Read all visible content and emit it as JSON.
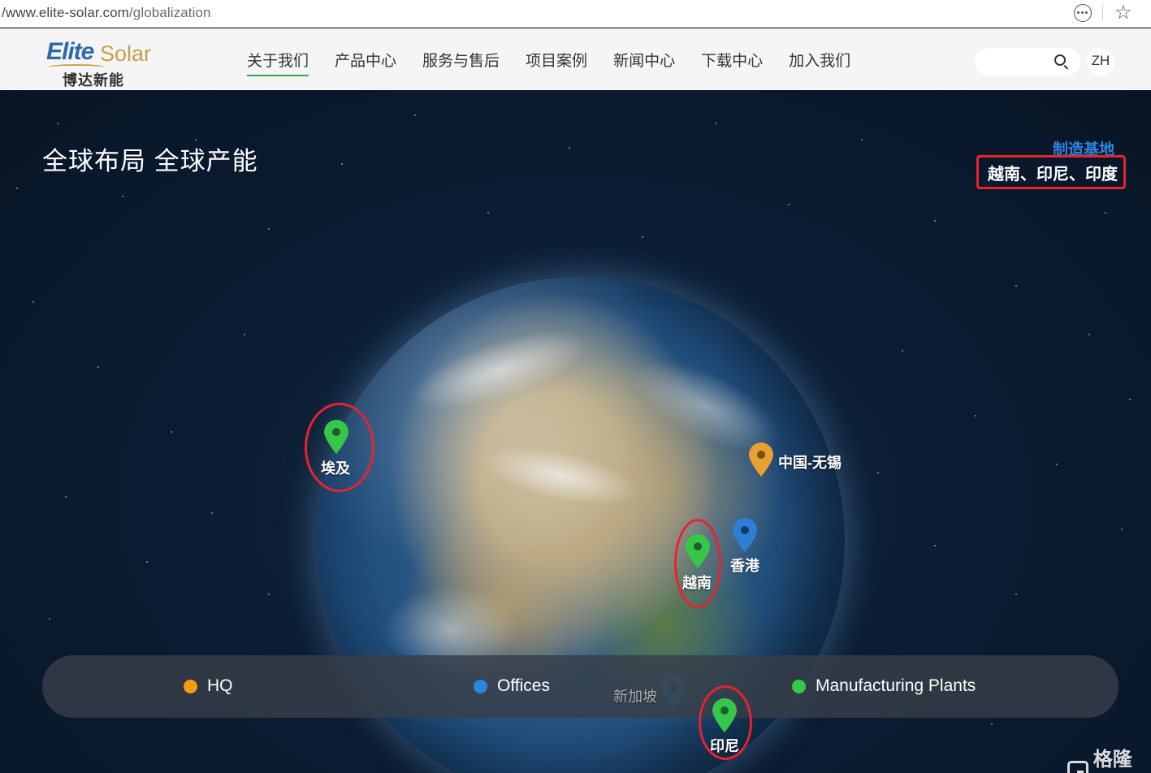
{
  "browser": {
    "url_host": "/www.elite-solar.com",
    "url_path": "/globalization",
    "more_icon": "more-horizontal-icon",
    "favorite_icon": "star-icon"
  },
  "header": {
    "logo": {
      "brand_1": "Elite",
      "brand_2": "Solar",
      "cn_name": "博达新能"
    },
    "nav": [
      {
        "label": "关于我们",
        "active": true
      },
      {
        "label": "产品中心"
      },
      {
        "label": "服务与售后"
      },
      {
        "label": "项目案例"
      },
      {
        "label": "新闻中心"
      },
      {
        "label": "下载中心"
      },
      {
        "label": "加入我们"
      }
    ],
    "search": {
      "placeholder": "",
      "icon": "search-icon"
    },
    "language": "ZH"
  },
  "hero": {
    "title": "全球布局 全球产能",
    "manufacturing_label": "制造基地",
    "manufacturing_list": "越南、印尼、印度"
  },
  "pins": {
    "egypt": {
      "label": "埃及",
      "type": "manufacturing"
    },
    "wuxi": {
      "label": "中国-无锡",
      "type": "hq"
    },
    "hongkong": {
      "label": "香港",
      "type": "office"
    },
    "vietnam": {
      "label": "越南",
      "type": "manufacturing"
    },
    "singapore": {
      "label": "新加坡",
      "type": "office"
    },
    "indonesia": {
      "label": "印尼",
      "type": "manufacturing"
    }
  },
  "legend": {
    "hq": {
      "label": "HQ",
      "color": "#f39c12"
    },
    "offices": {
      "label": "Offices",
      "color": "#2b86e0"
    },
    "manufacturing": {
      "label": "Manufacturing Plants",
      "color": "#35c74a"
    }
  },
  "colors": {
    "highlight_red": "#e6232e",
    "hq": "#e8a030",
    "office": "#2b80d6",
    "manufacturing": "#35c74a"
  },
  "watermark": "格隆汇"
}
